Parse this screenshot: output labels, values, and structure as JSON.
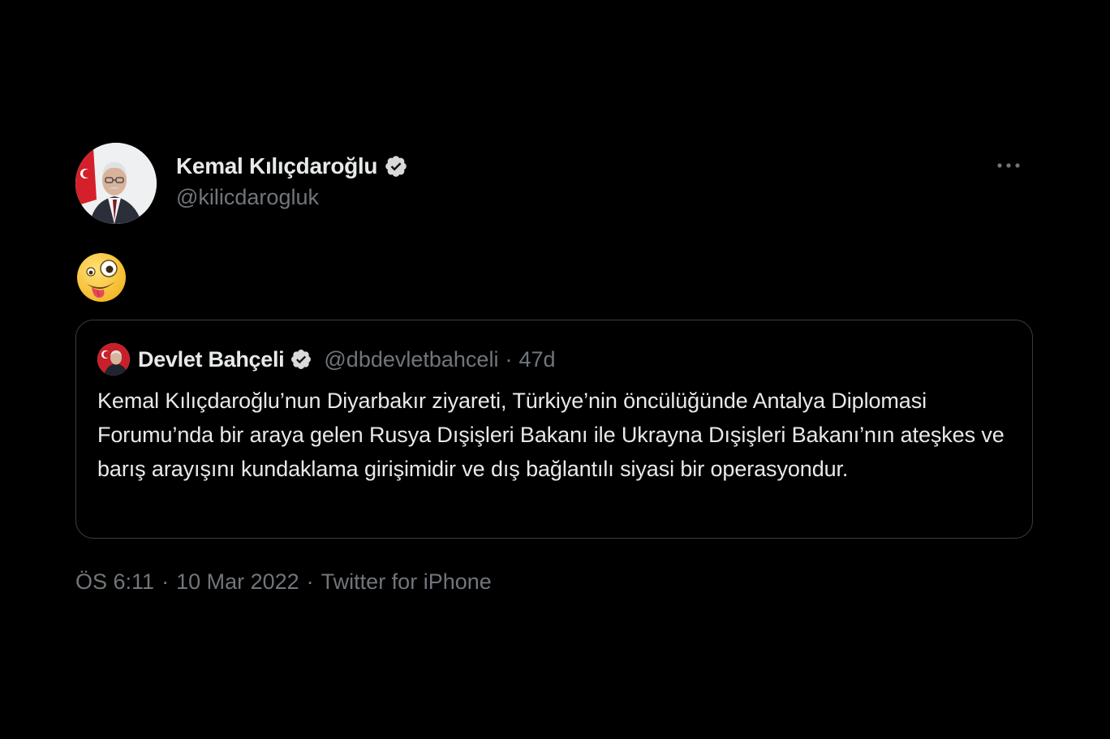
{
  "tweet": {
    "author": {
      "display_name": "Kemal Kılıçdaroğlu",
      "handle": "@kilicdarogluk",
      "avatar_icon": "profile-photo",
      "verified_icon": "verified-badge-icon"
    },
    "more_icon": "more-options-icon",
    "body_emoji": "🤪",
    "quote": {
      "display_name": "Devlet Bahçeli",
      "handle": "@dbdevletbahceli",
      "separator": "·",
      "time": "47d",
      "text": "Kemal Kılıçdaroğlu’nun Diyarbakır ziyareti, Türkiye’nin öncülüğünde Antalya Diplomasi Forumu’nda bir araya gelen Rusya Dışişleri Bakanı ile Ukrayna Dışişleri Bakanı’nın ateşkes ve barış arayışını kundaklama girişimidir ve dış bağlantılı siyasi bir operasyondur."
    },
    "meta": {
      "time": "ÖS 6:11",
      "separator": "·",
      "date": "10 Mar 2022",
      "source": "Twitter for iPhone"
    }
  },
  "colors": {
    "background": "#000000",
    "text_primary": "#e7e9ea",
    "text_secondary": "#71767b",
    "border": "#3a3d41"
  }
}
